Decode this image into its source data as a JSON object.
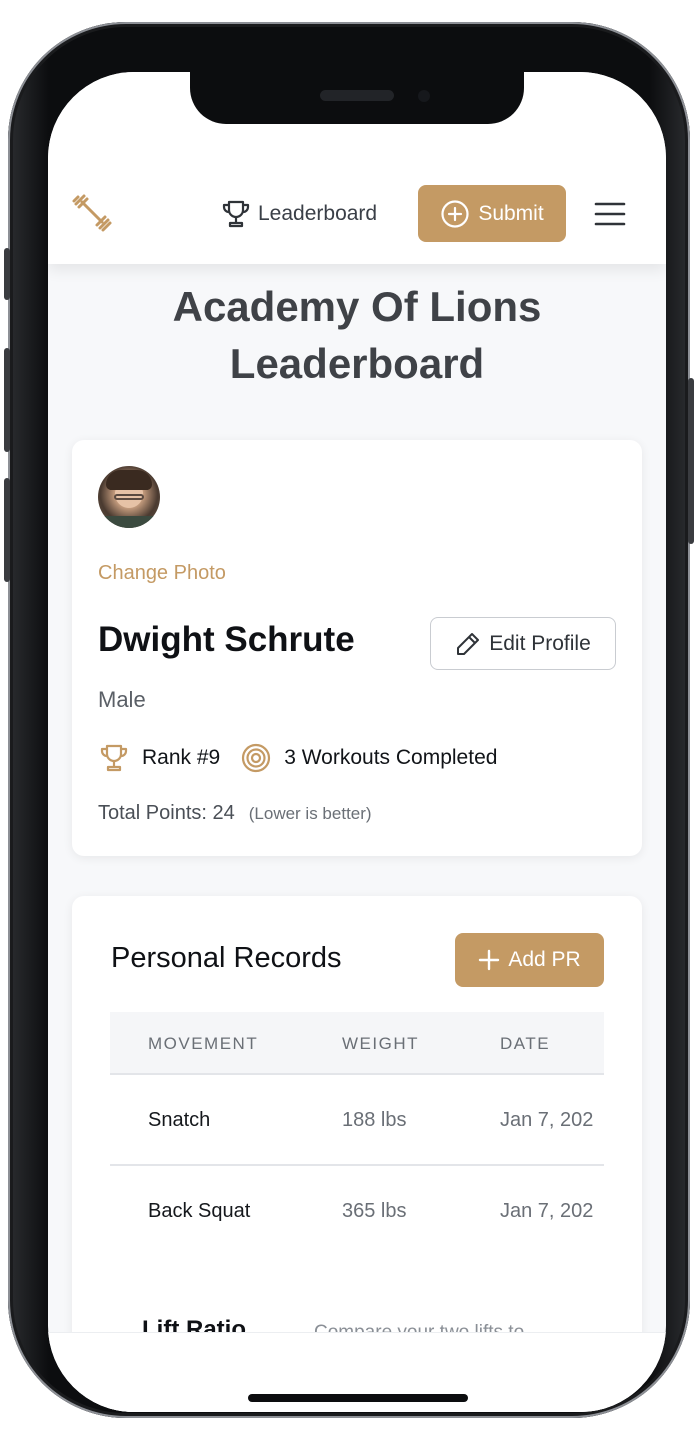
{
  "header": {
    "nav_leaderboard_label": "Leaderboard",
    "submit_label": "Submit"
  },
  "page": {
    "title": "Academy Of Lions Leaderboard"
  },
  "profile": {
    "change_photo_label": "Change Photo",
    "name": "Dwight Schrute",
    "edit_profile_label": "Edit Profile",
    "gender": "Male",
    "rank_text": "Rank #9",
    "workouts_text": "3 Workouts Completed",
    "total_points_text": "Total Points: 24",
    "points_note": "(Lower is better)"
  },
  "personal_records": {
    "title": "Personal Records",
    "add_pr_label": "Add PR",
    "columns": [
      "MOVEMENT",
      "WEIGHT",
      "DATE"
    ],
    "rows": [
      {
        "movement": "Snatch",
        "weight": "188 lbs",
        "date": "Jan 7, 202"
      },
      {
        "movement": "Back Squat",
        "weight": "365 lbs",
        "date": "Jan 7, 202"
      }
    ]
  },
  "lift_ratio": {
    "title": "Lift Ratio",
    "description": "Compare your two lifts to"
  },
  "colors": {
    "accent": "#c49a64",
    "title_text": "#3f4247",
    "background": "#f7f8fa"
  },
  "icons": {
    "logo": "dumbbell-icon",
    "leaderboard": "trophy-icon",
    "submit": "plus-circle-icon",
    "menu": "hamburger-menu-icon",
    "edit": "pencil-icon",
    "rank": "trophy-icon",
    "workouts": "target-icon",
    "add": "plus-icon"
  }
}
